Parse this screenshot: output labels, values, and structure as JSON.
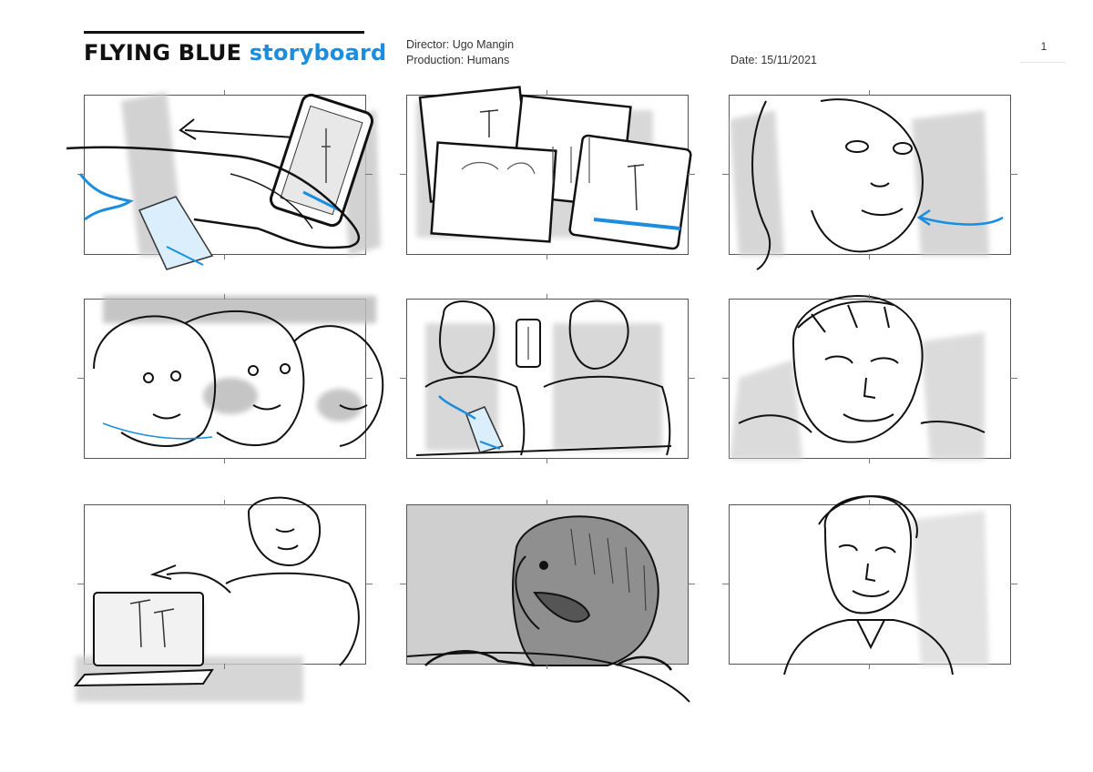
{
  "header": {
    "title_main": "FLYING BLUE",
    "title_accent": "storyboard",
    "director": "Director: Ugo Mangin",
    "production": "Production: Humans",
    "date": "Date: 15/11/2021",
    "page_number": "1"
  },
  "colors": {
    "accent": "#1a8de0",
    "ink": "#111111",
    "wash": "#bdbdbd"
  },
  "panels": [
    {
      "scene": "hand-phone-water-glass",
      "icons": [
        "swipe-arrow-icon",
        "phone-icon",
        "water-glass-icon"
      ]
    },
    {
      "scene": "photo-frames",
      "icons": [
        "photo-frame-icon",
        "palm-tree-icon"
      ]
    },
    {
      "scene": "girl-face-turning",
      "icons": [
        "turn-arrow-icon"
      ]
    },
    {
      "scene": "boy-face-triple-turn",
      "icons": [
        "face-icon"
      ]
    },
    {
      "scene": "girl-shows-phone-to-boy",
      "icons": [
        "phone-icon",
        "water-glass-icon"
      ]
    },
    {
      "scene": "boy-smirk-closeup",
      "icons": [
        "face-icon"
      ]
    },
    {
      "scene": "woman-with-laptop",
      "icons": [
        "laptop-icon",
        "palm-tree-icon"
      ]
    },
    {
      "scene": "shaggy-dog",
      "icons": [
        "dog-icon"
      ]
    },
    {
      "scene": "man-portrait",
      "icons": [
        "face-icon"
      ]
    }
  ]
}
